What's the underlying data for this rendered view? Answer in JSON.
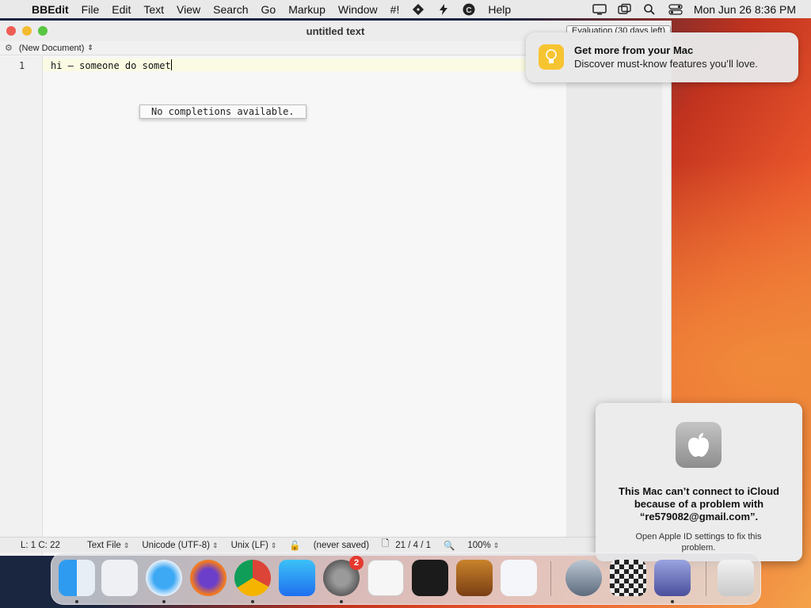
{
  "menubar": {
    "apple_glyph": "",
    "app_name": "BBEdit",
    "items": [
      "File",
      "Edit",
      "Text",
      "View",
      "Search",
      "Go",
      "Markup",
      "Window",
      "#!"
    ],
    "help": "Help",
    "clock": "Mon Jun 26  8:36 PM"
  },
  "window": {
    "title": "untitled text",
    "evaluation": "Evaluation (30 days left)",
    "nav_label": "(New Document)",
    "line_number": "1",
    "text_line": "hi – someone do somet",
    "completion": "No completions available."
  },
  "status": {
    "position": "L: 1 C: 22",
    "type": "Text File",
    "encoding": "Unicode (UTF-8)",
    "line_endings": "Unix (LF)",
    "saved": "(never saved)",
    "counts": "21 / 4 / 1",
    "zoom": "100%"
  },
  "notification": {
    "title": "Get more from your Mac",
    "body": "Discover must-know features you’ll love."
  },
  "icloud": {
    "message": "This Mac can’t connect to iCloud because of a problem with “re579082@gmail.com”.",
    "sub": "Open Apple ID settings to fix this problem."
  },
  "dock": {
    "items": [
      "finder",
      "launchpad",
      "safari",
      "firefox",
      "chrome",
      "app-store",
      "system-settings",
      "textedit",
      "terminal",
      "garageband",
      "vscode",
      "preview",
      "chess",
      "bbedit",
      "trash"
    ],
    "settings_badge": "2"
  },
  "colors": {
    "close": "#ee5d55",
    "minimize": "#f3bb2f",
    "zoom": "#59c641",
    "current_line": "#fbfbe3",
    "badge": "#e5392f"
  }
}
